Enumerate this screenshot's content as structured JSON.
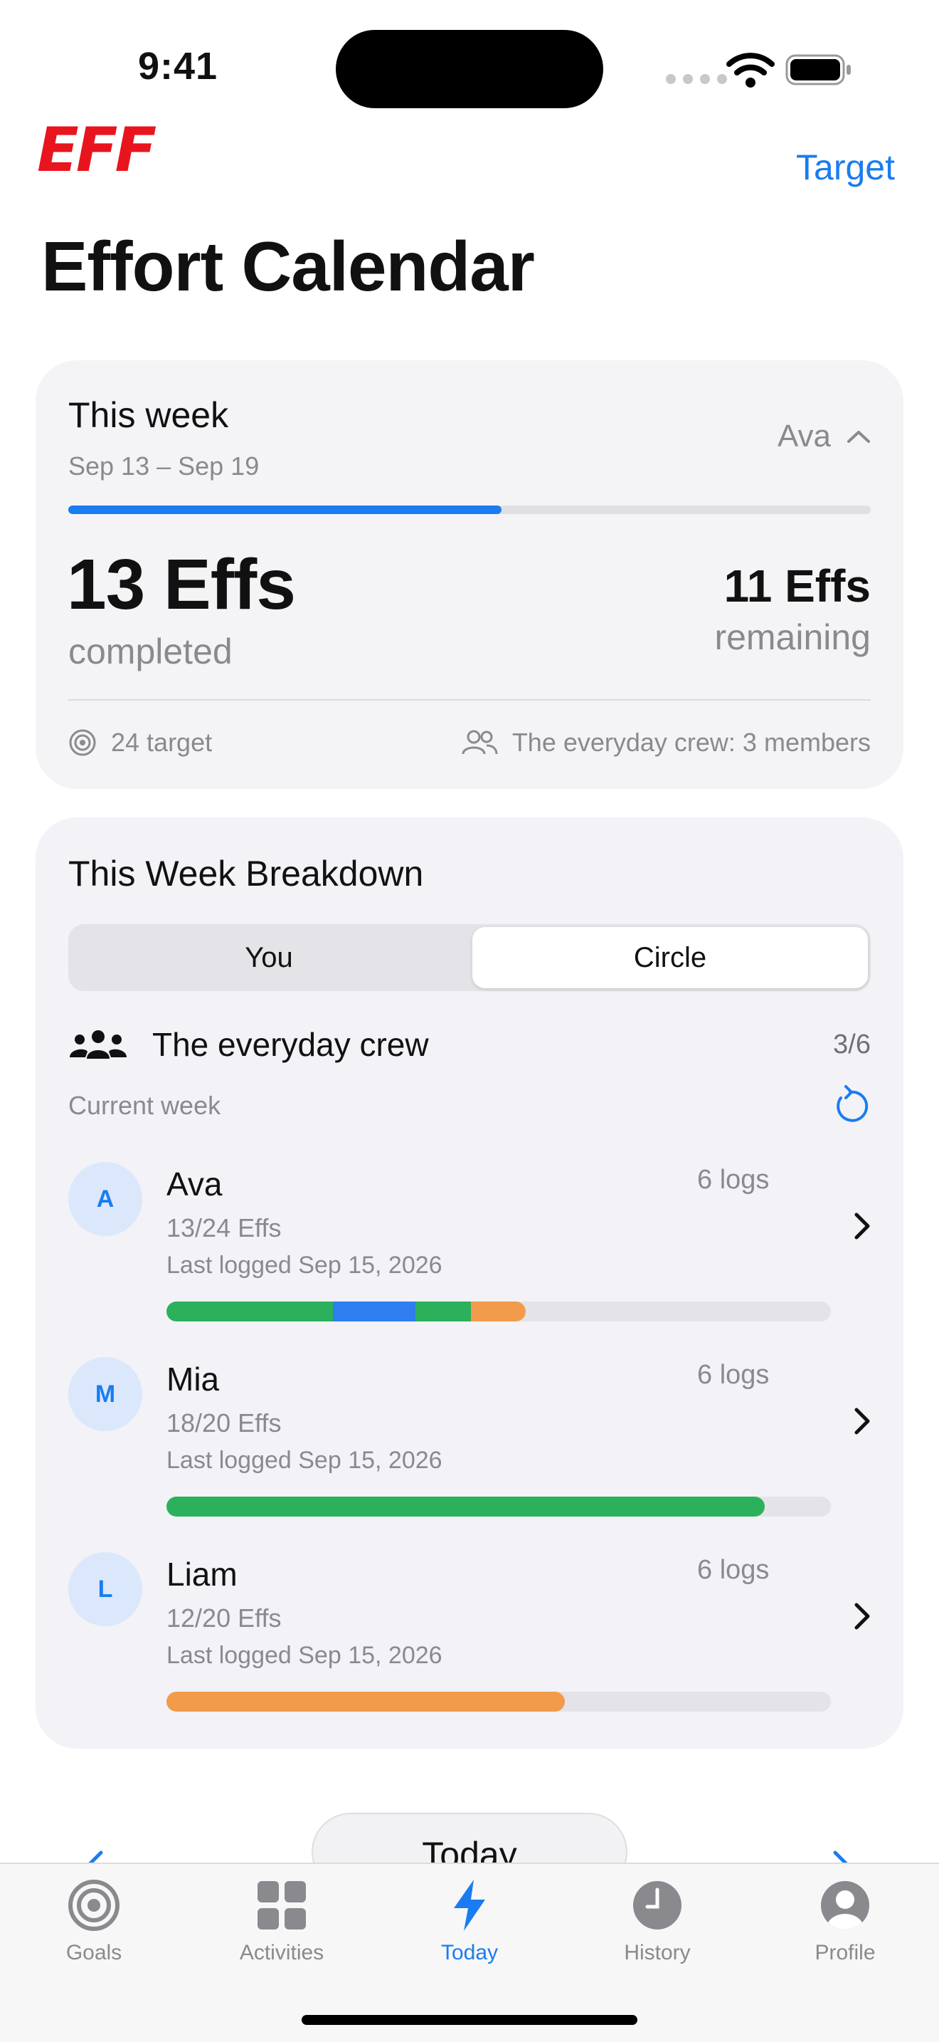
{
  "status_bar": {
    "time": "9:41"
  },
  "header": {
    "brand": "EFF",
    "target_label": "Target",
    "title": "Effort Calendar"
  },
  "summary": {
    "week_title": "This week",
    "date_range": "Sep 13 – Sep 19",
    "selected_user": "Ava",
    "progress_fraction": 0.54,
    "completed_value": "13 Effs",
    "completed_label": "completed",
    "remaining_value": "11 Effs",
    "remaining_label": "remaining",
    "target_text": "24 target",
    "crew_text": "The everyday crew: 3 members"
  },
  "breakdown": {
    "title": "This Week Breakdown",
    "segments": [
      "You",
      "Circle"
    ],
    "selected_segment": "Circle",
    "crew_name": "The everyday crew",
    "crew_count": "3/6",
    "period_label": "Current week",
    "members": [
      {
        "initial": "A",
        "name": "Ava",
        "effs": "13/24 Effs",
        "last_logged": "Last logged Sep 15, 2026",
        "logs": "6 logs",
        "bar": [
          {
            "color": "#2cb05c",
            "fraction": 0.25
          },
          {
            "color": "#2f7ef0",
            "fraction": 0.125
          },
          {
            "color": "#2cb05c",
            "fraction": 0.083
          },
          {
            "color": "#f29b4a",
            "fraction": 0.083
          }
        ]
      },
      {
        "initial": "M",
        "name": "Mia",
        "effs": "18/20 Effs",
        "last_logged": "Last logged Sep 15, 2026",
        "logs": "6 logs",
        "bar": [
          {
            "color": "#2cb05c",
            "fraction": 0.9
          }
        ]
      },
      {
        "initial": "L",
        "name": "Liam",
        "effs": "12/20 Effs",
        "last_logged": "Last logged Sep 15, 2026",
        "logs": "6 logs",
        "bar": [
          {
            "color": "#f29b4a",
            "fraction": 0.6
          }
        ]
      }
    ]
  },
  "week_nav": {
    "center_label": "Today"
  },
  "tabs": [
    {
      "label": "Goals",
      "icon": "target-icon",
      "active": false
    },
    {
      "label": "Activities",
      "icon": "grid-icon",
      "active": false
    },
    {
      "label": "Today",
      "icon": "bolt-icon",
      "active": true
    },
    {
      "label": "History",
      "icon": "clock-icon",
      "active": false
    },
    {
      "label": "Profile",
      "icon": "person-icon",
      "active": false
    }
  ],
  "colors": {
    "accent": "#1a7cf0",
    "brand": "#e8141e",
    "green": "#2cb05c",
    "orange": "#f29b4a",
    "blue": "#2f7ef0"
  }
}
